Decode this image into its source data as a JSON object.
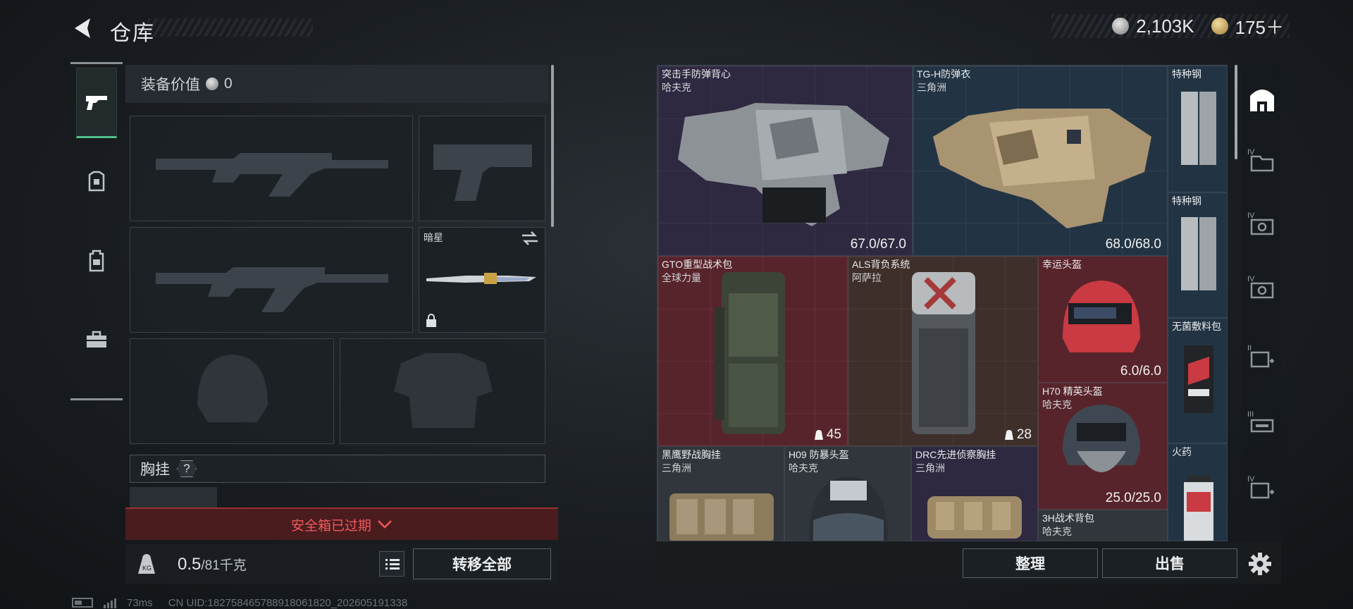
{
  "header": {
    "title": "仓库",
    "currency_silver": "2,103K",
    "currency_gold": "175＋"
  },
  "equipment": {
    "value_label": "装备价值",
    "value": "0",
    "melee_slot_label": "暗星",
    "chest_label": "胸挂",
    "chest_help": "?",
    "safebox_status": "安全箱已过期",
    "weight_current": "0.5",
    "weight_max": "/81千克",
    "transfer_all": "转移全部"
  },
  "storage": {
    "items": [
      {
        "name": "突击手防弹背心",
        "brand": "哈夫克",
        "durability": "67.0/67.0"
      },
      {
        "name": "TG-H防弹衣",
        "brand": "三角洲",
        "durability": "68.0/68.0"
      },
      {
        "name": "特种钢",
        "brand": ""
      },
      {
        "name": "特种钢",
        "brand": ""
      },
      {
        "name": "GTO重型战术包",
        "brand": "全球力量",
        "capacity": "45"
      },
      {
        "name": "ALS背负系统",
        "brand": "阿萨拉",
        "capacity": "28"
      },
      {
        "name": "幸运头盔",
        "brand": "",
        "durability": "6.0/6.0"
      },
      {
        "name": "无菌敷料包",
        "brand": ""
      },
      {
        "name": "H70 精英头盔",
        "brand": "哈夫克",
        "durability": "25.0/25.0"
      },
      {
        "name": "黑鹰野战胸挂",
        "brand": "三角洲"
      },
      {
        "name": "H09 防暴头盔",
        "brand": "哈夫克"
      },
      {
        "name": "DRC先进侦察胸挂",
        "brand": "三角洲"
      },
      {
        "name": "火药",
        "brand": ""
      },
      {
        "name": "3H战术背包",
        "brand": "哈夫克"
      }
    ],
    "side_tab_levels": [
      "IV",
      "IV",
      "IV",
      "II",
      "III",
      "IV"
    ],
    "sort_button": "整理",
    "sell_button": "出售"
  },
  "status": {
    "ping": "73ms",
    "uid": "CN UID:1827584657889180618​20_202605191338"
  },
  "colors": {
    "accent_green": "#4fbf8a",
    "expired_red": "#f0595b",
    "rarity_red": "#62262e",
    "rarity_blue": "#24384a",
    "rarity_purple": "#322c48"
  },
  "icons": [
    "back-arrow-icon",
    "silver-coin-icon",
    "gold-coin-icon",
    "pistol-icon",
    "armor-icon",
    "backpack-icon",
    "briefcase-icon",
    "lock-icon",
    "swap-icon",
    "weight-icon",
    "list-icon",
    "gear-icon",
    "chevron-down-icon"
  ]
}
